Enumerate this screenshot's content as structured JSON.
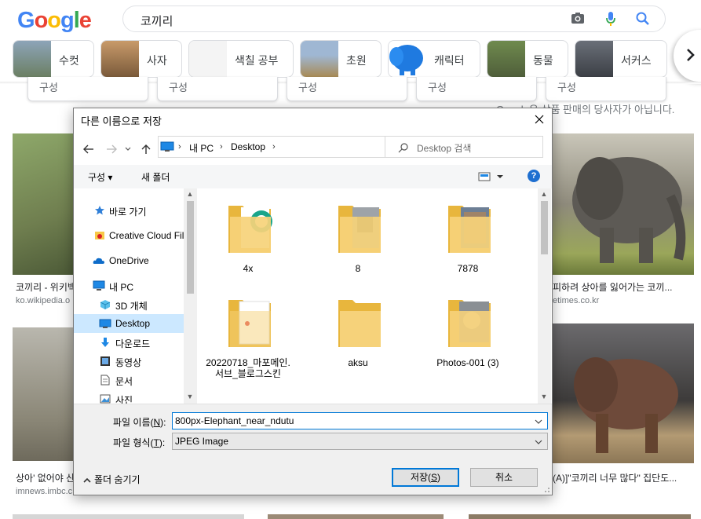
{
  "google": {
    "logo": [
      "G",
      "o",
      "o",
      "g",
      "l",
      "e"
    ],
    "query": "코끼리",
    "chips": [
      "수컷",
      "사자",
      "색칠 공부",
      "초원",
      "캐릭터",
      "동물",
      "서커스"
    ],
    "filters": [
      "구성",
      "구성",
      "구성",
      "구성",
      "구성"
    ],
    "sell_note": "Google은 상품 판매의 당사자가 아닙니다.",
    "results": [
      {
        "caption": "코끼리 - 위키백",
        "source": "ko.wikipedia.o"
      },
      {
        "caption": "피하려 상아를 잃어가는 코끼...",
        "source": "etimes.co.kr"
      },
      {
        "caption": "상아' 없어야 산",
        "source": "imnews.imbc.c"
      },
      {
        "caption": "(A)]\"코끼리 너무 많다\" 집단도...",
        "source": ""
      }
    ]
  },
  "dialog": {
    "title": "다른 이름으로 저장",
    "address": [
      "내 PC",
      "Desktop"
    ],
    "search_placeholder": "Desktop 검색",
    "toolbar": {
      "organize": "구성 ▾",
      "new_folder": "새 폴더",
      "help": "?"
    },
    "tree": [
      {
        "label": "바로 가기",
        "icon": "star-icon"
      },
      {
        "label": "Creative Cloud Fil",
        "icon": "creative-cloud-icon"
      },
      {
        "label": "OneDrive",
        "icon": "onedrive-icon"
      },
      {
        "label": "내 PC",
        "icon": "pc-icon"
      },
      {
        "label": "3D 개체",
        "icon": "cube-icon"
      },
      {
        "label": "Desktop",
        "icon": "desktop-icon",
        "selected": true
      },
      {
        "label": "다운로드",
        "icon": "download-icon"
      },
      {
        "label": "동영상",
        "icon": "video-icon"
      },
      {
        "label": "문서",
        "icon": "document-icon"
      },
      {
        "label": "사진",
        "icon": "pictures-icon"
      }
    ],
    "files": [
      {
        "name": "4x"
      },
      {
        "name": "8"
      },
      {
        "name": "7878"
      },
      {
        "name": "20220718_마포메인.서브_블로그스킨"
      },
      {
        "name": "aksu"
      },
      {
        "name": "Photos-001 (3)"
      }
    ],
    "filename_label": "파일 이름(",
    "filename_key": "N",
    "filename_label_end": "):",
    "filename_value": "800px-Elephant_near_ndutu",
    "filetype_label": "파일 형식(",
    "filetype_key": "T",
    "filetype_label_end": "):",
    "filetype_value": "JPEG Image",
    "hide_folders": "폴더 숨기기",
    "save_label": "저장(",
    "save_key": "S",
    "save_label_end": ")",
    "cancel_label": "취소"
  }
}
